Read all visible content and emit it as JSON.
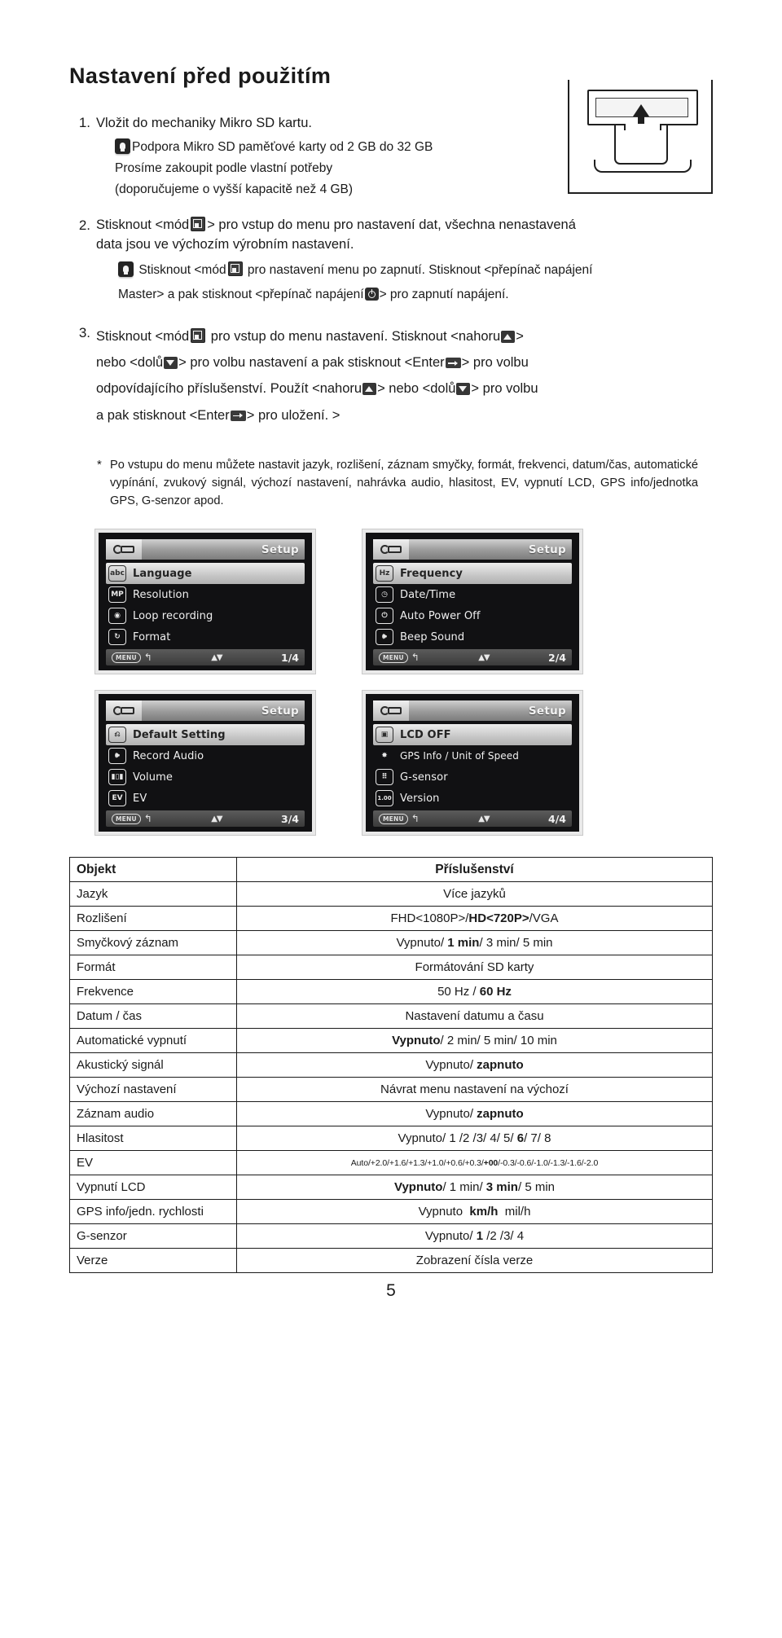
{
  "title": "Nastavení před použitím",
  "steps": [
    {
      "num": "1.",
      "text": "Vložit do mechaniky Mikro SD kartu.",
      "note_lines": [
        "Podpora  Mikro  SD paměťové karty od 2 GB do 32 GB",
        "Prosíme zakoupit podle vlastní potřeby",
        "(doporučujeme o vyšší kapacitě než 4 GB)"
      ]
    },
    {
      "num": "2.",
      "lead": "Stisknout <mód",
      "mid": "> pro vstup do menu pro nastavení dat, všechna nenastavená",
      "line2": "data jsou ve výchozím výrobním nastavení.",
      "sub_a1": "Stisknout <mód",
      "sub_a2": "pro nastavení menu po zapnutí. Stisknout <přepínač napájení",
      "sub_b1": "Master> a pak stisknout <přepínač napájení",
      "sub_b2": "> pro zapnutí napájení."
    },
    {
      "num": "3.",
      "l1a": "Stisknout <mód",
      "l1b": "pro vstup do menu nastavení. Stisknout <nahoru",
      "l1c": ">",
      "l2a": "nebo  <dolů",
      "l2b": "> pro volbu nastavení a pak stisknout <Enter",
      "l2c": "> pro volbu",
      "l3a": "odpovídajícího příslušenství. Použít <nahoru",
      "l3b": "> nebo <dolů",
      "l3c": "> pro volbu",
      "l4a": "a pak stisknout <Enter",
      "l4b": "> pro uložení. >"
    }
  ],
  "note": {
    "star": "*",
    "text": "Po vstupu do menu můžete nastavit jazyk, rozlišení, záznam smyčky, formát, frekvenci, datum/čas, automatické vypínání, zvukový signál, výchozí nastavení, nahrávka audio, hlasitost, EV, vypnutí LCD, GPS info/jednotka GPS, G-senzor apod."
  },
  "screens": [
    {
      "header": "Setup",
      "page": "1/4",
      "items": [
        {
          "icon": "abc",
          "label": "Language",
          "selected": true
        },
        {
          "icon": "MP",
          "label": "Resolution",
          "selected": false
        },
        {
          "icon": "loop",
          "label": "Loop recording",
          "selected": false
        },
        {
          "icon": "format",
          "label": "Format",
          "selected": false
        }
      ]
    },
    {
      "header": "Setup",
      "page": "2/4",
      "items": [
        {
          "icon": "Hz",
          "label": "Frequency",
          "selected": true
        },
        {
          "icon": "clock",
          "label": "Date/Time",
          "selected": false
        },
        {
          "icon": "power",
          "label": "Auto Power Off",
          "selected": false
        },
        {
          "icon": "speaker",
          "label": "Beep Sound",
          "selected": false
        }
      ]
    },
    {
      "header": "Setup",
      "page": "3/4",
      "items": [
        {
          "icon": "default",
          "label": "Default Setting",
          "selected": true
        },
        {
          "icon": "speaker",
          "label": "Record Audio",
          "selected": false
        },
        {
          "icon": "bars",
          "label": "Volume",
          "selected": false
        },
        {
          "icon": "EV",
          "label": "EV",
          "selected": false
        }
      ]
    },
    {
      "header": "Setup",
      "page": "4/4",
      "items": [
        {
          "icon": "lcdoff",
          "label": "LCD OFF",
          "selected": true
        },
        {
          "icon": "gps",
          "label": "GPS Info / Unit of Speed",
          "selected": false
        },
        {
          "icon": "gsensor",
          "label": "G-sensor",
          "selected": false
        },
        {
          "icon": "version",
          "label": "Version",
          "selected": false
        }
      ]
    }
  ],
  "menu_button_label": "MENU",
  "table": {
    "headers": [
      "Objekt",
      "Příslušenství"
    ],
    "rows": [
      {
        "key": "Jazyk",
        "value": "Více jazyků"
      },
      {
        "key": "Rozlišení",
        "value": "FHD<1080P>/HD<720P>/VGA"
      },
      {
        "key": "Smyčkový záznam",
        "value": "Vypnuto/ 1 min/ 3 min/ 5 min"
      },
      {
        "key": "Formát",
        "value": "Formátování SD karty"
      },
      {
        "key": "Frekvence",
        "value": "50 Hz / 60 Hz"
      },
      {
        "key": "Datum / čas",
        "value": "Nastavení datumu a času"
      },
      {
        "key": "Automatické vypnutí",
        "value": "Vypnuto/ 2 min/ 5 min/ 10 min"
      },
      {
        "key": "Akustický signál",
        "value": "Vypnuto/ zapnuto"
      },
      {
        "key": "Výchozí nastavení",
        "value": "Návrat menu nastavení na výchozí"
      },
      {
        "key": "Záznam audio",
        "value": "Vypnuto/ zapnuto"
      },
      {
        "key": "Hlasitost",
        "value": "Vypnuto/ 1 /2 /3/ 4/ 5/ 6/ 7/ 8"
      },
      {
        "key": "EV",
        "value": "Auto/+2.0/+1.6/+1.3/+1.0/+0.6/+0.3/+00/-0.3/-0.6/-1.0/-1.3/-1.6/-2.0"
      },
      {
        "key": "Vypnutí LCD",
        "value": "Vypnuto/ 1 min/ 3 min/ 5 min"
      },
      {
        "key": "GPS info/jedn. rychlosti",
        "value": "Vypnuto  km/h  mil/h"
      },
      {
        "key": "G-senzor",
        "value": "Vypnuto/ 1 /2 /3/ 4"
      },
      {
        "key": "Verze",
        "value": "Zobrazení čísla verze"
      }
    ]
  },
  "folio": "5"
}
